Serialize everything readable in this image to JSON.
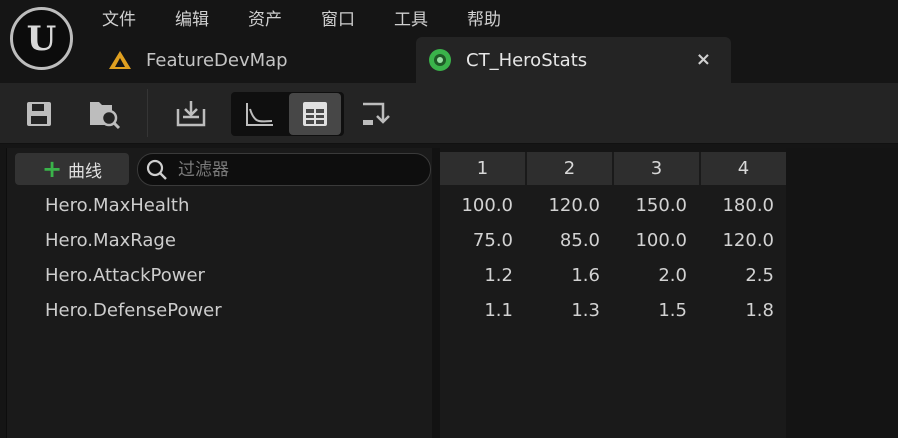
{
  "logo": {
    "glyph": "U"
  },
  "menu": [
    "文件",
    "编辑",
    "资产",
    "窗口",
    "工具",
    "帮助"
  ],
  "tabs": [
    {
      "label": "FeatureDevMap",
      "icon": "map-icon",
      "active": false
    },
    {
      "label": "CT_HeroStats",
      "icon": "curve-table-icon",
      "active": true,
      "close": "×"
    }
  ],
  "toolbar": {
    "buttons": [
      "save-icon",
      "browse-asset-icon",
      "reimport-icon",
      "curve-view-icon",
      "table-view-icon",
      "append-row-icon"
    ],
    "active_view": "table"
  },
  "left": {
    "add_button": {
      "plus": "+",
      "label": "曲线"
    },
    "search": {
      "placeholder": "过滤器"
    },
    "rows": [
      "Hero.MaxHealth",
      "Hero.MaxRage",
      "Hero.AttackPower",
      "Hero.DefensePower"
    ]
  },
  "table": {
    "columns": [
      "1",
      "2",
      "3",
      "4"
    ],
    "rows": [
      [
        "100.0",
        "120.0",
        "150.0",
        "180.0"
      ],
      [
        "75.0",
        "85.0",
        "100.0",
        "120.0"
      ],
      [
        "1.2",
        "1.6",
        "2.0",
        "2.5"
      ],
      [
        "1.1",
        "1.3",
        "1.5",
        "1.8"
      ]
    ]
  },
  "colors": {
    "accent_green": "#3ab34a",
    "map_icon_orange": "#e0a020",
    "corner_blue": "#2f7fe0"
  }
}
